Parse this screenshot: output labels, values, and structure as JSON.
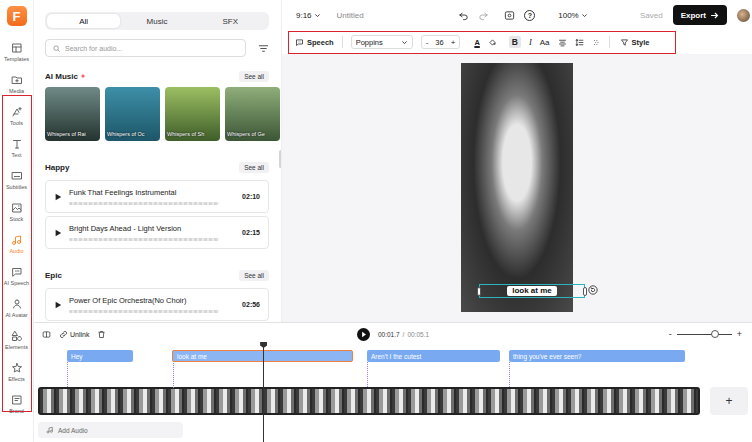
{
  "logo": "F",
  "sidebar": {
    "items": [
      {
        "label": "Templates",
        "selected": false
      },
      {
        "label": "Media",
        "selected": false
      },
      {
        "label": "Tools",
        "selected": false
      },
      {
        "label": "Text",
        "selected": false
      },
      {
        "label": "Subtitles",
        "selected": false
      },
      {
        "label": "Stock",
        "selected": false
      },
      {
        "label": "Audio",
        "selected": true
      },
      {
        "label": "AI Speech",
        "selected": false
      },
      {
        "label": "AI Avatar",
        "selected": false
      },
      {
        "label": "Elements",
        "selected": false
      },
      {
        "label": "Effects",
        "selected": false
      },
      {
        "label": "Brand",
        "selected": false
      }
    ]
  },
  "library": {
    "tabs": [
      {
        "label": "All",
        "selected": true
      },
      {
        "label": "Music",
        "selected": false
      },
      {
        "label": "SFX",
        "selected": false
      }
    ],
    "search": {
      "placeholder": "Search for audio..."
    },
    "ai_music": {
      "title": "AI Music",
      "see_all": "See all",
      "cards": [
        {
          "title": "Whispers of Rai"
        },
        {
          "title": "Whispers of Oc"
        },
        {
          "title": "Whispers of Sh"
        },
        {
          "title": "Whispers of Ge"
        }
      ]
    },
    "sections": [
      {
        "title": "Happy",
        "see_all": "See all",
        "tracks": [
          {
            "title": "Funk That Feelings Instrumental",
            "duration": "02:10"
          },
          {
            "title": "Bright Days Ahead - Light Version",
            "duration": "02:15"
          }
        ]
      },
      {
        "title": "Epic",
        "see_all": "See all",
        "tracks": [
          {
            "title": "Power Of Epic Orchestra(No Choir)",
            "duration": "02:56"
          }
        ]
      }
    ]
  },
  "topbar": {
    "ratio": "9:16",
    "title": "Untitled",
    "help": "?",
    "zoom": "100%",
    "status": "Saved",
    "export": "Export"
  },
  "toolbar": {
    "speech": "Speech",
    "font": "Poppins",
    "decrease": "-",
    "size": "36",
    "increase": "+",
    "color_letter": "A",
    "bold": {
      "label": "B",
      "selected": true
    },
    "italic": "I",
    "case": "Aa",
    "style": "Style"
  },
  "canvas": {
    "caption": "look at me"
  },
  "timeline": {
    "unlink": "Unlink",
    "current": "00:01.7",
    "separator": "/",
    "total": "00:05.1",
    "zoom_out": "-",
    "zoom_in": "+",
    "zoom_level": 0.7,
    "playhead_level": 0.34,
    "subtitles": [
      {
        "text": "Hey",
        "selected": false
      },
      {
        "text": "look at me",
        "selected": true
      },
      {
        "text": "Aren't I the cutest",
        "selected": false
      },
      {
        "text": "thing you've ever seen?",
        "selected": false
      }
    ],
    "add_clip": "+",
    "add_audio": "Add Audio"
  }
}
